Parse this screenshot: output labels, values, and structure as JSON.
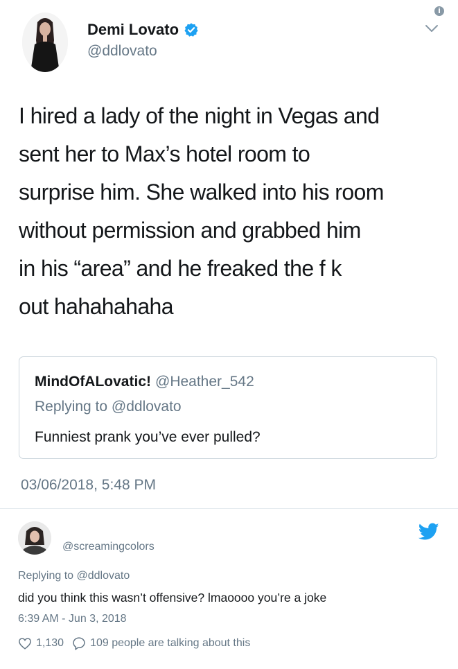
{
  "tweet": {
    "author_name": "Demi Lovato",
    "author_handle": "@ddlovato",
    "verified": true,
    "text": "I hired a lady of the night in Vegas and\nsent her to Max’s hotel room to\nsurprise him. She walked into his room\nwithout permission and grabbed him\nin his “area” and he freaked the f    k\nout hahahahaha",
    "timestamp": "03/06/2018, 5:48 PM"
  },
  "quoted_tweet": {
    "author_name": "MindOfALovatic!",
    "author_handle": "@Heather_542",
    "replying_to": "Replying to @ddlovato",
    "text": "Funniest prank you’ve ever pulled?"
  },
  "reply_tweet": {
    "author_handle": "@screamingcolors",
    "replying_to": "Replying to @ddlovato",
    "text": "did you think this wasn’t offensive? lmaoooo you’re a joke",
    "timestamp": "6:39 AM - Jun 3, 2018",
    "like_count": "1,130",
    "talking_text": "109 people are talking about this"
  },
  "icons": {
    "info": "info-icon",
    "chevron": "chevron-down-icon",
    "verified": "verified-badge-icon",
    "twitter": "twitter-bird-icon",
    "like": "heart-icon",
    "reply": "comment-icon"
  },
  "colors": {
    "text_primary": "#14171a",
    "text_secondary": "#657786",
    "verified_blue": "#1da1f2",
    "twitter_blue": "#1da1f2",
    "border": "#ccd6dd"
  }
}
